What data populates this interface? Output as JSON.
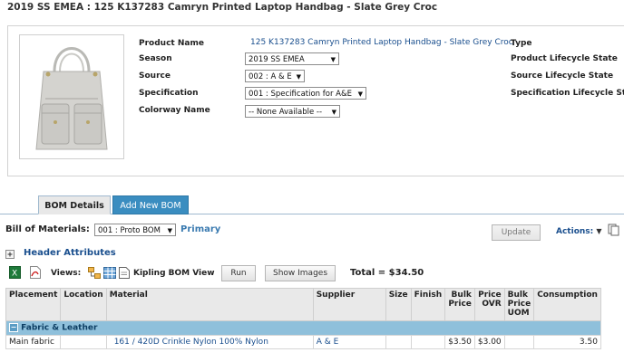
{
  "page_title": "2019 SS EMEA : 125 K137283 Camryn Printed Laptop Handbag - Slate Grey Croc",
  "product": {
    "fields": {
      "product_name_label": "Product Name",
      "product_name_value": "125 K137283 Camryn Printed Laptop Handbag - Slate Grey Croc",
      "season_label": "Season",
      "season_value": "2019 SS EMEA",
      "source_label": "Source",
      "source_value": "002 : A & E",
      "specification_label": "Specification",
      "specification_value": "001 : Specification for A&E",
      "colorway_label": "Colorway Name",
      "colorway_value": "-- None Available --"
    },
    "right_labels": [
      "Type",
      "Product Lifecycle State",
      "Source Lifecycle State",
      "Specification Lifecycle State"
    ]
  },
  "tabs": [
    {
      "label": "BOM Details"
    },
    {
      "label": "Add New BOM"
    }
  ],
  "bom": {
    "label": "Bill of Materials:",
    "select_value": "001 : Proto BOM",
    "primary_label": "Primary",
    "update_button": "Update",
    "actions_label": "Actions:"
  },
  "header_attributes": {
    "toggle": "+",
    "label": "Header Attributes"
  },
  "views": {
    "label": "Views:",
    "view_name": "Kipling BOM View",
    "run_button": "Run",
    "show_images_button": "Show Images",
    "total_label": "Total = $34.50"
  },
  "table": {
    "headers": [
      "Placement",
      "Location",
      "Material",
      "Supplier",
      "Size",
      "Finish",
      "Bulk Price",
      "Price OVR",
      "Bulk Price UOM",
      "Consumption"
    ],
    "group": {
      "toggle": "−",
      "label": "Fabric & Leather"
    },
    "rows": [
      {
        "placement": "Main fabric",
        "location": "",
        "material": "161 / 420D Crinkle Nylon 100% Nylon",
        "supplier": "A & E",
        "size": "",
        "finish": "",
        "bulk_price": "$3.50",
        "price_ovr": "$3.00",
        "bulk_price_uom": "",
        "consumption": "3.50"
      }
    ]
  },
  "colors": {
    "link": "#1a4f8e",
    "tab_active_bg": "#e8e8e8",
    "tab_inactive_bg": "#3a8dc0",
    "group_row_bg": "#8fc0db",
    "header_bg": "#e9e9e9"
  },
  "icons": [
    "expand-plus-icon",
    "excel-export-icon",
    "pdf-export-icon",
    "view-tree-icon",
    "view-grid-icon",
    "view-document-icon",
    "actions-dropdown-arrow-icon",
    "copy-page-icon",
    "collapse-minus-icon",
    "dropdown-arrow-icon"
  ]
}
